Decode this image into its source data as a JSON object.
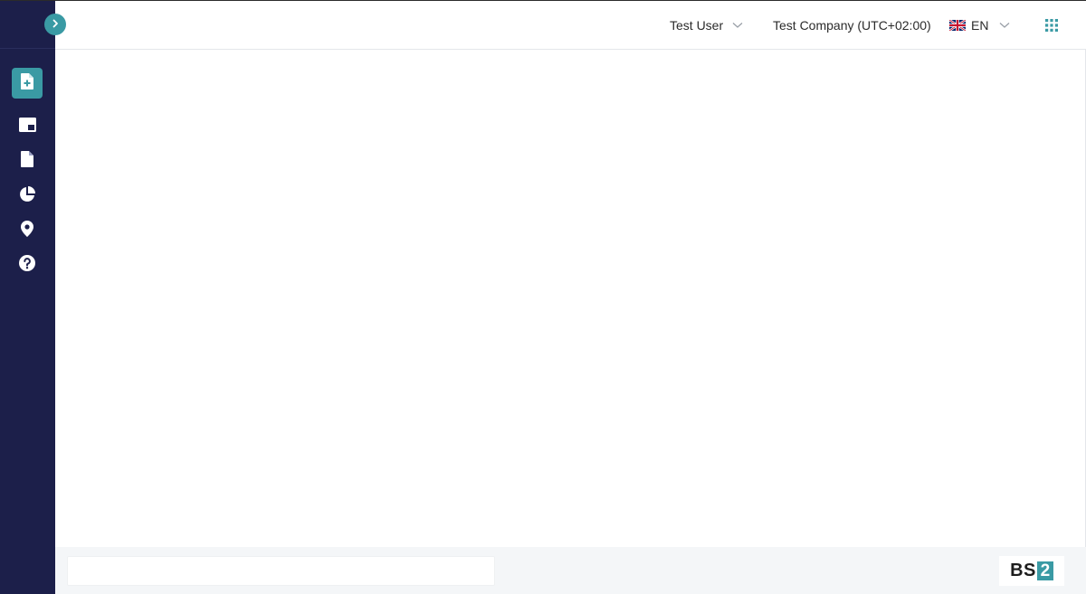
{
  "header": {
    "user_name": "Test User",
    "company": "Test Company (UTC+02:00)",
    "language": "EN"
  },
  "sidebar": {
    "items": [
      {
        "name": "new-document",
        "icon": "file-plus-icon",
        "active": true
      },
      {
        "name": "dashboard",
        "icon": "window-icon",
        "active": false
      },
      {
        "name": "documents",
        "icon": "file-icon",
        "active": false
      },
      {
        "name": "reports",
        "icon": "pie-chart-icon",
        "active": false
      },
      {
        "name": "locations",
        "icon": "map-pin-icon",
        "active": false
      },
      {
        "name": "help",
        "icon": "question-circle-icon",
        "active": false
      }
    ]
  },
  "footer": {
    "logo_text": "BS",
    "logo_box_text": "2"
  },
  "colors": {
    "sidebar_bg": "#1c1f4a",
    "accent": "#3a9aa4",
    "footer_bg": "#f4f6f8"
  }
}
